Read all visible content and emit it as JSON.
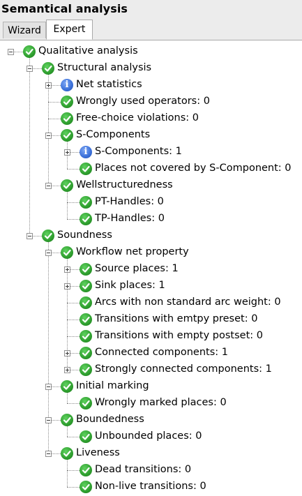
{
  "panel": {
    "title": "Semantical analysis",
    "tabs": [
      {
        "label": "Wizard",
        "active": false
      },
      {
        "label": "Expert",
        "active": true
      }
    ]
  },
  "tree": {
    "n_qualitative": "Qualitative analysis",
    "n_structural": "Structural analysis",
    "n_netstats": "Net statistics",
    "n_wrongops": "Wrongly used operators: 0",
    "n_freechoice": "Free-choice violations: 0",
    "n_scomp": "S-Components",
    "n_scomp_count": "S-Components: 1",
    "n_places_notcovered": "Places not covered by S-Component: 0",
    "n_wellstruct": "Wellstructuredness",
    "n_pthandles": "PT-Handles: 0",
    "n_tphandles": "TP-Handles: 0",
    "n_soundness": "Soundness",
    "n_workflow": "Workflow net property",
    "n_source": "Source places: 1",
    "n_sink": "Sink places: 1",
    "n_arcs": "Arcs with non standard arc weight: 0",
    "n_emptypreset": "Transitions with emtpy preset: 0",
    "n_emptypostset": "Transitions with empty postset: 0",
    "n_connected": "Connected components: 1",
    "n_strongly": "Strongly connected components: 1",
    "n_initial": "Initial marking",
    "n_wrongmarked": "Wrongly marked places: 0",
    "n_bounded": "Boundedness",
    "n_unbounded": "Unbounded places: 0",
    "n_liveness": "Liveness",
    "n_dead": "Dead transitions: 0",
    "n_nonlive": "Non-live transitions: 0"
  },
  "icons": {
    "ok": "check-circle-icon",
    "info": "info-icon",
    "expand": "plus-box-icon",
    "collapse": "minus-box-icon",
    "ok_color": "#2e9e2e",
    "info_color": "#3a6fd8",
    "info_glyph": "i"
  }
}
